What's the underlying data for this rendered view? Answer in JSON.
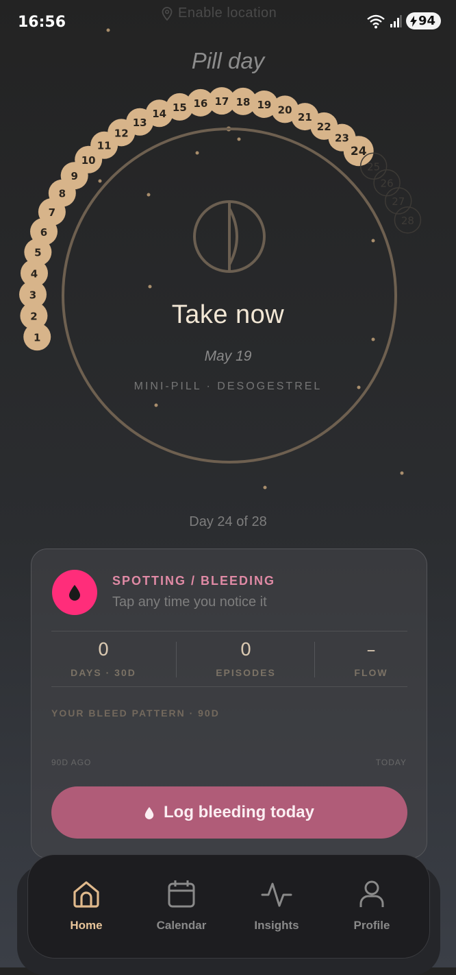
{
  "status": {
    "time": "16:56",
    "battery": "94",
    "location_hint": "Enable location"
  },
  "header": {
    "title": "Pill day"
  },
  "pill_ring": {
    "total": 28,
    "taken_through": 24,
    "current_day": 24,
    "action_label": "Take now",
    "date": "May 19",
    "pill_type": "MINI-PILL · DESOGESTREL",
    "day_counter": "Day 24 of 28"
  },
  "colors": {
    "accent": "#d7b48a",
    "bleed_pink": "#ff2d7a",
    "button_pink": "#b05c78",
    "ring": "#6e6050"
  },
  "bleeding_card": {
    "title": "SPOTTING / BLEEDING",
    "subtitle": "Tap any time you notice it",
    "stats": [
      {
        "value": "0",
        "label": "DAYS · 30D"
      },
      {
        "value": "0",
        "label": "EPISODES"
      },
      {
        "value": "–",
        "label": "FLOW"
      }
    ],
    "pattern_title": "YOUR BLEED PATTERN · 90D",
    "range_start": "90D AGO",
    "range_end": "TODAY",
    "log_button": "Log bleeding today"
  },
  "nav": {
    "items": [
      {
        "label": "Home",
        "icon": "home-icon",
        "active": true
      },
      {
        "label": "Calendar",
        "icon": "calendar-icon",
        "active": false
      },
      {
        "label": "Insights",
        "icon": "pulse-icon",
        "active": false
      },
      {
        "label": "Profile",
        "icon": "person-icon",
        "active": false
      }
    ]
  }
}
